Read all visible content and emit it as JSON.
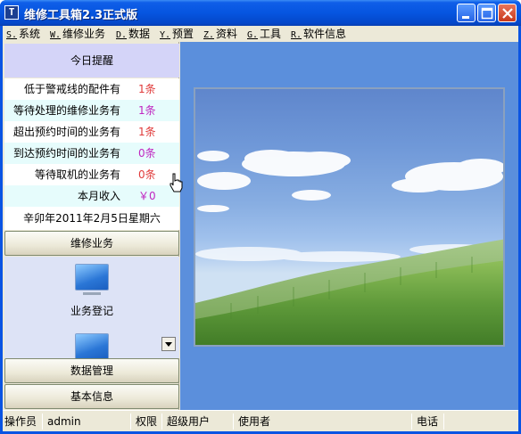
{
  "window": {
    "title": "维修工具箱2.3正式版",
    "app_icon_glyph": "T"
  },
  "menu": [
    {
      "key": "S.",
      "label": "系统"
    },
    {
      "key": "W.",
      "label": "维修业务"
    },
    {
      "key": "D.",
      "label": "数据"
    },
    {
      "key": "Y.",
      "label": "预置"
    },
    {
      "key": "Z.",
      "label": "资料"
    },
    {
      "key": "G.",
      "label": "工具"
    },
    {
      "key": "R.",
      "label": "软件信息"
    }
  ],
  "reminders": {
    "title": "今日提醒",
    "rows": [
      {
        "label": "低于警戒线的配件有",
        "value": "1条"
      },
      {
        "label": "等待处理的维修业务有",
        "value": "1条"
      },
      {
        "label": "超出预约时间的业务有",
        "value": "1条"
      },
      {
        "label": "到达预约时间的业务有",
        "value": "0条"
      },
      {
        "label": "等待取机的业务有",
        "value": "0条"
      },
      {
        "label": "本月收入",
        "value": "￥0"
      }
    ],
    "date": "辛卯年2011年2月5日星期六"
  },
  "nav": {
    "group_repair": "维修业务",
    "repair_items": [
      {
        "label": "业务登记",
        "icon": "monitor-icon"
      }
    ],
    "group_data": "数据管理",
    "group_basic": "基本信息"
  },
  "status": {
    "operator_label": "操作员",
    "operator_value": "admin",
    "permission_label": "权限",
    "permission_value": "超级用户",
    "user_label": "使用者",
    "phone_label": "电话"
  },
  "colors": {
    "title_blue": "#0655e0",
    "content_blue": "#5b8fdc",
    "reminder_red": "#e03a3a",
    "reminder_magenta": "#c026c0"
  }
}
